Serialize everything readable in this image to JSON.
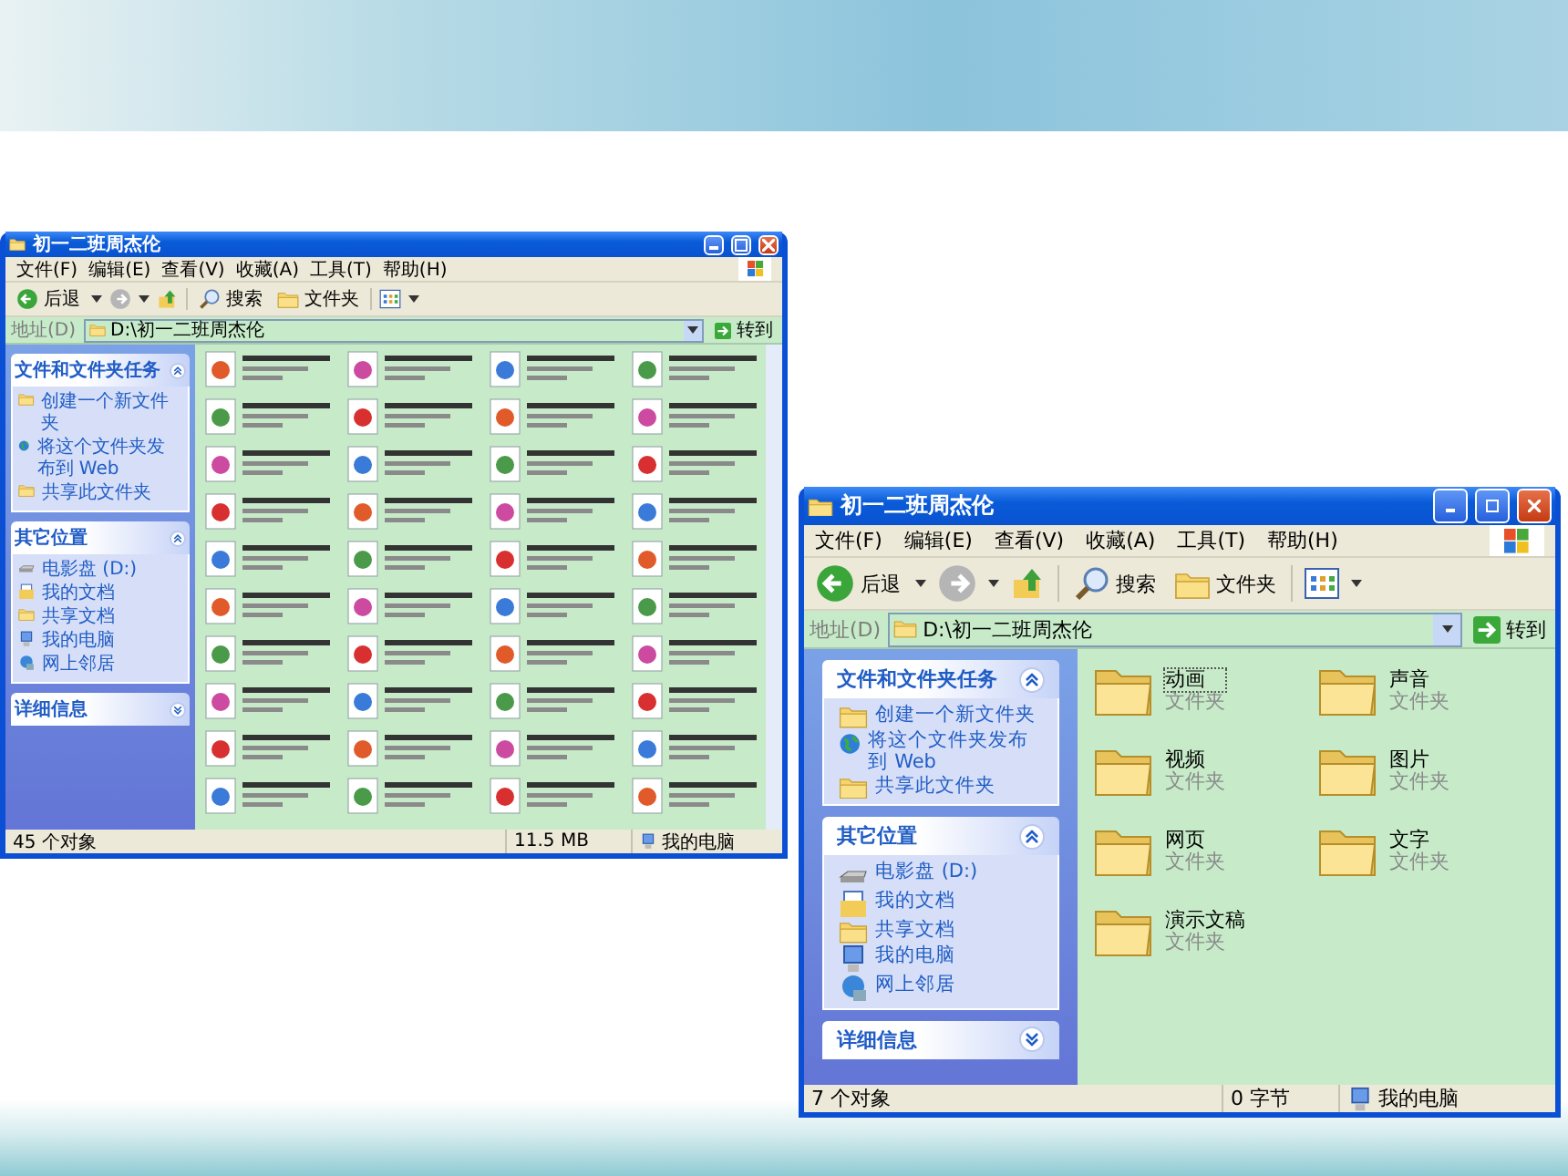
{
  "windows": [
    {
      "title": "初一二班周杰伦",
      "menu": [
        "文件(F)",
        "编辑(E)",
        "查看(V)",
        "收藏(A)",
        "工具(T)",
        "帮助(H)"
      ],
      "toolbar": {
        "back": "后退",
        "search": "搜索",
        "folders": "文件夹"
      },
      "address": {
        "label": "地址(D)",
        "path": "D:\\初一二班周杰伦",
        "go": "转到"
      },
      "panels": [
        {
          "title": "文件和文件夹任务",
          "expanded": true,
          "items": [
            "创建一个新文件夹",
            "将这个文件夹发布到 Web",
            "共享此文件夹"
          ]
        },
        {
          "title": "其它位置",
          "expanded": true,
          "items": [
            "电影盘 (D:)",
            "我的文档",
            "共享文档",
            "我的电脑",
            "网上邻居"
          ]
        },
        {
          "title": "详细信息",
          "expanded": false
        }
      ],
      "status": [
        "45 个对象",
        "11.5 MB",
        "我的电脑"
      ]
    },
    {
      "title": "初一二班周杰伦",
      "menu": [
        "文件(F)",
        "编辑(E)",
        "查看(V)",
        "收藏(A)",
        "工具(T)",
        "帮助(H)"
      ],
      "toolbar": {
        "back": "后退",
        "search": "搜索",
        "folders": "文件夹"
      },
      "address": {
        "label": "地址(D)",
        "path": "D:\\初一二班周杰伦",
        "go": "转到"
      },
      "panels": [
        {
          "title": "文件和文件夹任务",
          "expanded": true,
          "items": [
            "创建一个新文件夹",
            "将这个文件夹发布到 Web",
            "共享此文件夹"
          ]
        },
        {
          "title": "其它位置",
          "expanded": true,
          "items": [
            "电影盘 (D:)",
            "我的文档",
            "共享文档",
            "我的电脑",
            "网上邻居"
          ]
        },
        {
          "title": "详细信息",
          "expanded": false
        }
      ],
      "files": [
        {
          "name": "动画",
          "type": "文件夹",
          "selected": true
        },
        {
          "name": "声音",
          "type": "文件夹",
          "selected": false
        },
        {
          "name": "视频",
          "type": "文件夹",
          "selected": false
        },
        {
          "name": "图片",
          "type": "文件夹",
          "selected": false
        },
        {
          "name": "网页",
          "type": "文件夹",
          "selected": false
        },
        {
          "name": "文字",
          "type": "文件夹",
          "selected": false
        },
        {
          "name": "演示文稿",
          "type": "文件夹",
          "selected": false
        }
      ],
      "status": [
        "7 个对象",
        "0 字节",
        "我的电脑"
      ]
    }
  ]
}
